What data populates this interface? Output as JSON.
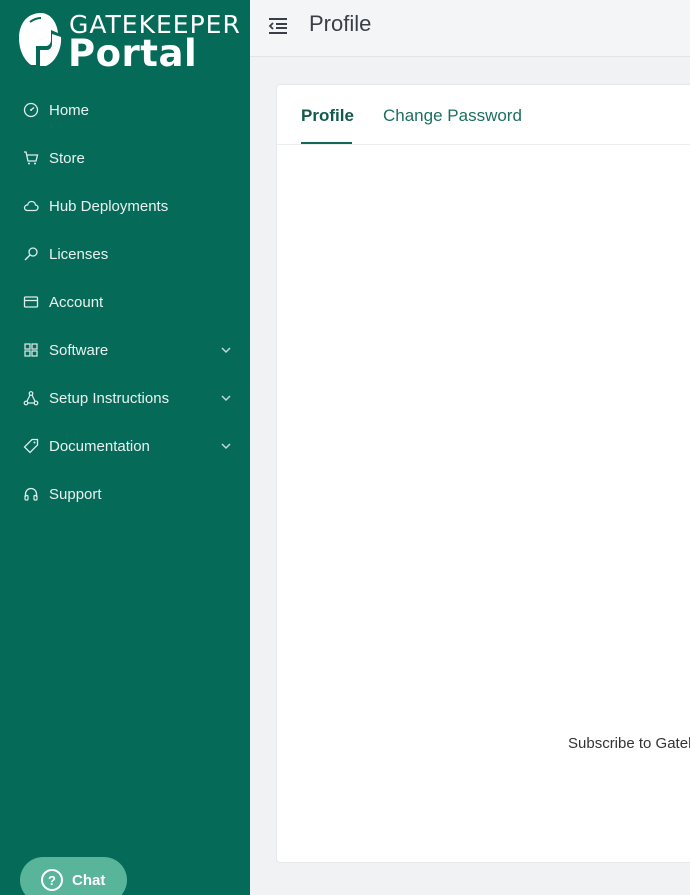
{
  "brand": {
    "top": "GATEKEEPER",
    "bottom": "Portal"
  },
  "sidebar": {
    "items": [
      {
        "label": "Home",
        "icon": "dashboard-gauge-icon",
        "has_submenu": false
      },
      {
        "label": "Store",
        "icon": "cart-icon",
        "has_submenu": false
      },
      {
        "label": "Hub Deployments",
        "icon": "cloud-icon",
        "has_submenu": false
      },
      {
        "label": "Licenses",
        "icon": "key-icon",
        "has_submenu": false
      },
      {
        "label": "Account",
        "icon": "credit-card-icon",
        "has_submenu": false
      },
      {
        "label": "Software",
        "icon": "grid-icon",
        "has_submenu": true
      },
      {
        "label": "Setup Instructions",
        "icon": "network-icon",
        "has_submenu": true
      },
      {
        "label": "Documentation",
        "icon": "tag-icon",
        "has_submenu": true
      },
      {
        "label": "Support",
        "icon": "headphones-icon",
        "has_submenu": false
      }
    ]
  },
  "chat": {
    "label": "Chat",
    "icon_glyph": "?"
  },
  "header": {
    "title": "Profile"
  },
  "tabs": [
    {
      "label": "Profile",
      "active": true
    },
    {
      "label": "Change Password",
      "active": false
    }
  ],
  "content": {
    "subscribe_text": "Subscribe to Gatek"
  },
  "colors": {
    "sidebar": "#066a59",
    "accent": "#0f6a59",
    "chat": "#58b59a"
  }
}
